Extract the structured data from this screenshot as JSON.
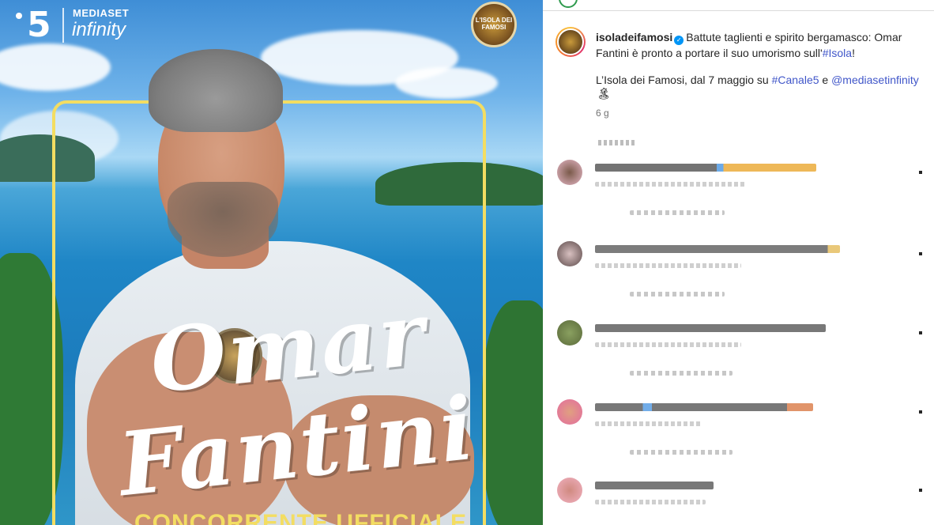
{
  "post_image": {
    "channel_logo": "5",
    "brand_top": "MEDIASET",
    "brand_bottom": "infinity",
    "show_logo_text": "L'ISOLA DEI FAMOSI",
    "name_first": "Omar",
    "name_last": "Fantini",
    "banner": "CONCORRENTE UFFICIALE"
  },
  "caption": {
    "username": "isoladeifamosi",
    "text_part1": "Battute taglienti e spirito bergamasco: Omar Fantini è pronto a portare il suo umorismo sull'",
    "hashtag_isola": "#Isola",
    "text_part1_end": "!",
    "line2_prefix": "L’Isola dei Famosi, dal 7 maggio su ",
    "hashtag_canale5": "#Canale5",
    "line2_mid": " e ",
    "mention": "@mediasetinfinity",
    "emoji": "🏝",
    "time_ago": "6 g"
  },
  "comments_count_blurred": 5,
  "colors": {
    "accent_link": "#00376b",
    "hashtag": "#4056c9",
    "verified": "#0095f6",
    "frame_yellow": "#f3dd62"
  }
}
